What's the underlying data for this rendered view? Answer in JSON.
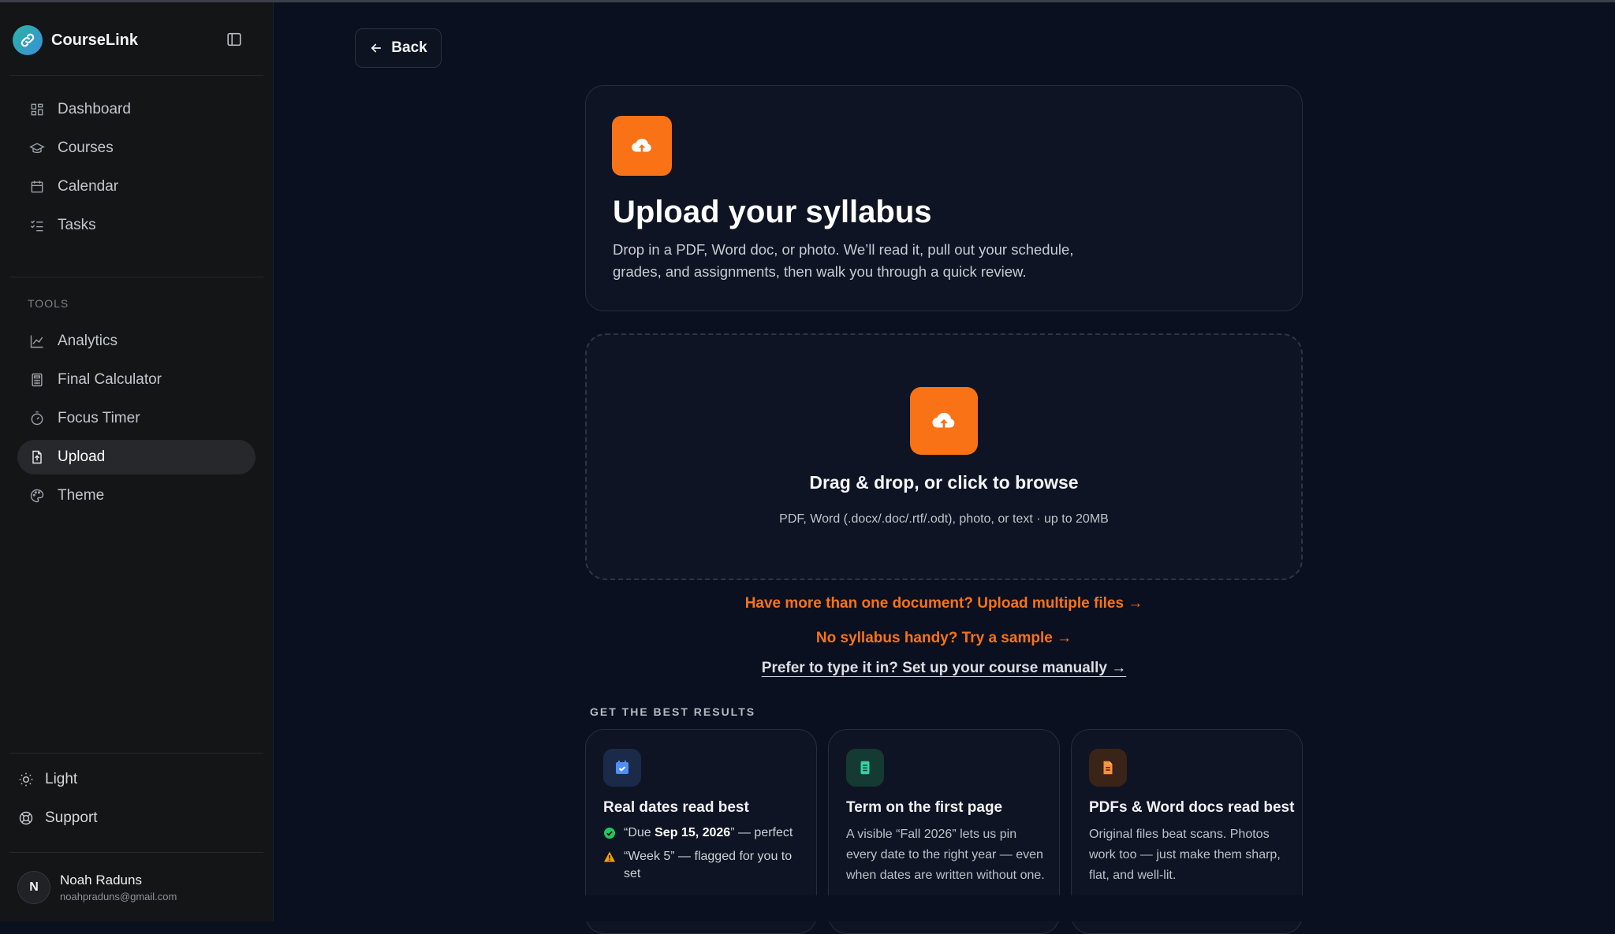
{
  "app": {
    "name": "CourseLink"
  },
  "sidebar": {
    "nav": [
      {
        "label": "Dashboard",
        "icon": "dashboard-icon"
      },
      {
        "label": "Courses",
        "icon": "graduation-cap-icon"
      },
      {
        "label": "Calendar",
        "icon": "calendar-icon"
      },
      {
        "label": "Tasks",
        "icon": "tasks-icon"
      }
    ],
    "tools_label": "TOOLS",
    "tools": [
      {
        "label": "Analytics",
        "icon": "line-chart-icon"
      },
      {
        "label": "Final Calculator",
        "icon": "calculator-icon"
      },
      {
        "label": "Focus Timer",
        "icon": "timer-icon"
      },
      {
        "label": "Upload",
        "icon": "file-upload-icon",
        "active": true
      },
      {
        "label": "Theme",
        "icon": "palette-icon"
      }
    ],
    "bottom": [
      {
        "label": "Light",
        "icon": "sun-icon"
      },
      {
        "label": "Support",
        "icon": "lifebuoy-icon"
      }
    ],
    "user": {
      "initial": "N",
      "name": "Noah Raduns",
      "email": "noahpraduns@gmail.com"
    }
  },
  "main": {
    "back_label": "Back",
    "hero": {
      "title": "Upload your syllabus",
      "description": "Drop in a PDF, Word doc, or photo. We’ll read it, pull out your schedule, grades, and assignments, then walk you through a quick review."
    },
    "dropzone": {
      "title": "Drag & drop, or click to browse",
      "subtitle": "PDF, Word (.docx/.doc/.rtf/.odt), photo, or text · up to 20MB"
    },
    "links": {
      "multiple": "Have more than one document? Upload multiple files →",
      "sample": "No syllabus handy? Try a sample →",
      "manual": "Prefer to type it in? Set up your course manually →"
    },
    "tips_label": "GET THE BEST RESULTS",
    "tips": [
      {
        "title": "Real dates read best",
        "icon": "calendar-check-icon",
        "row1_pre": "“Due ",
        "row1_bold": "Sep 15, 2026",
        "row1_post": "” — perfect",
        "row2": "“Week 5” — flagged for you to set"
      },
      {
        "title": "Term on the first page",
        "icon": "document-icon",
        "body": "A visible “Fall 2026” lets us pin every date to the right year — even when dates are written without one."
      },
      {
        "title": "PDFs & Word docs read best",
        "icon": "file-text-icon",
        "body": "Original files beat scans. Photos work too — just make them sharp, flat, and well-lit."
      }
    ]
  },
  "colors": {
    "accent": "#f97316",
    "background": "#0b1020",
    "sidebar": "#141516",
    "success": "#22c55e",
    "warning": "#f59e0b"
  }
}
